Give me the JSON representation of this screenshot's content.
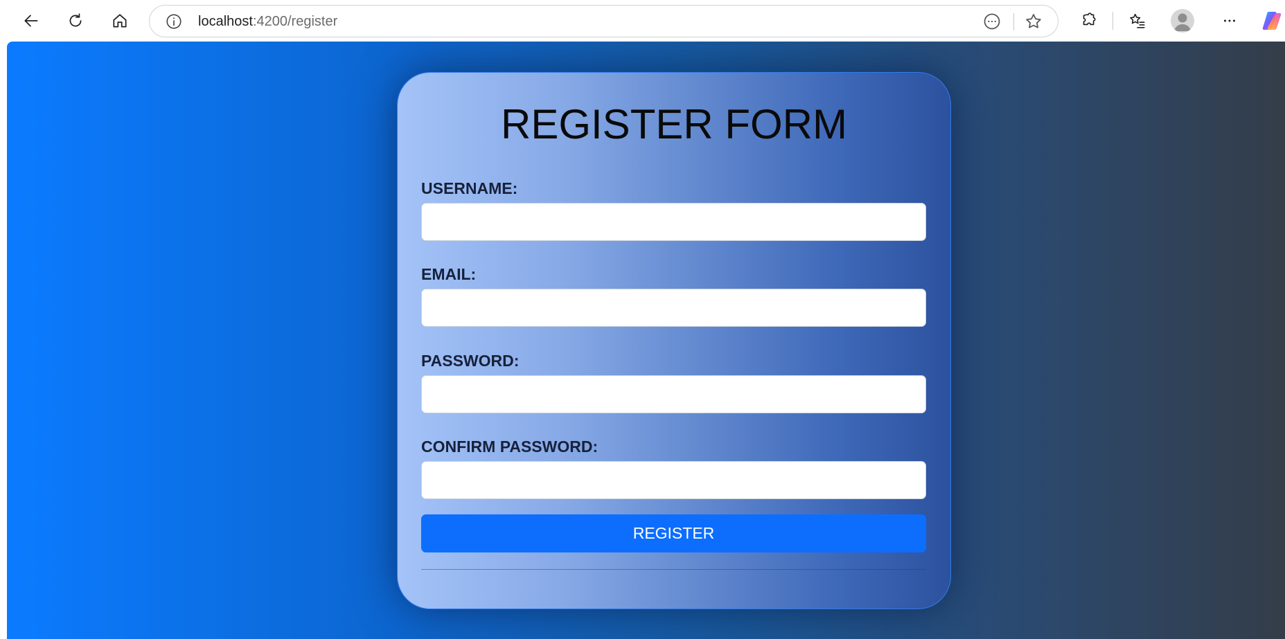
{
  "browser": {
    "url_host": "localhost",
    "url_path": ":4200/register"
  },
  "form": {
    "title": "REGISTER FORM",
    "fields": [
      {
        "label": "USERNAME:",
        "value": "",
        "placeholder": ""
      },
      {
        "label": "EMAIL:",
        "value": "",
        "placeholder": ""
      },
      {
        "label": "PASSWORD:",
        "value": "",
        "placeholder": ""
      },
      {
        "label": "CONFIRM PASSWORD:",
        "value": "",
        "placeholder": ""
      }
    ],
    "submit_label": "REGISTER"
  },
  "colors": {
    "button": "#0d6efd",
    "gradient_start": "#0b7bff",
    "gradient_end": "#343d49"
  }
}
